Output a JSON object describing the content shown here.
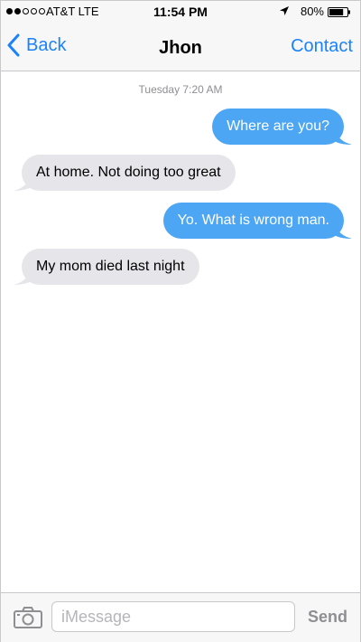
{
  "status_bar": {
    "carrier": "AT&T LTE",
    "time": "11:54 PM",
    "battery": "80%",
    "signal_bars_filled": 2,
    "signal_bars_total": 5,
    "battery_level": 0.8,
    "icons": [
      "signal-icon",
      "location-icon",
      "battery-icon"
    ]
  },
  "nav": {
    "back_label": "Back",
    "title": "Jhon",
    "contact_label": "Contact",
    "accent_color": "#1a82fb"
  },
  "conversation": {
    "timestamp": "Tuesday 7:20 AM",
    "messages": [
      {
        "direction": "outgoing",
        "text": "Where are you?"
      },
      {
        "direction": "incoming",
        "text": "At home. Not doing too great"
      },
      {
        "direction": "outgoing",
        "text": "Yo. What is wrong man."
      },
      {
        "direction": "incoming",
        "text": "My mom died last night"
      }
    ],
    "outgoing_color": "#4da6f3",
    "incoming_color": "#e5e5ea"
  },
  "input": {
    "placeholder": "iMessage",
    "value": "",
    "send_label": "Send",
    "camera_icon": "camera-icon"
  }
}
